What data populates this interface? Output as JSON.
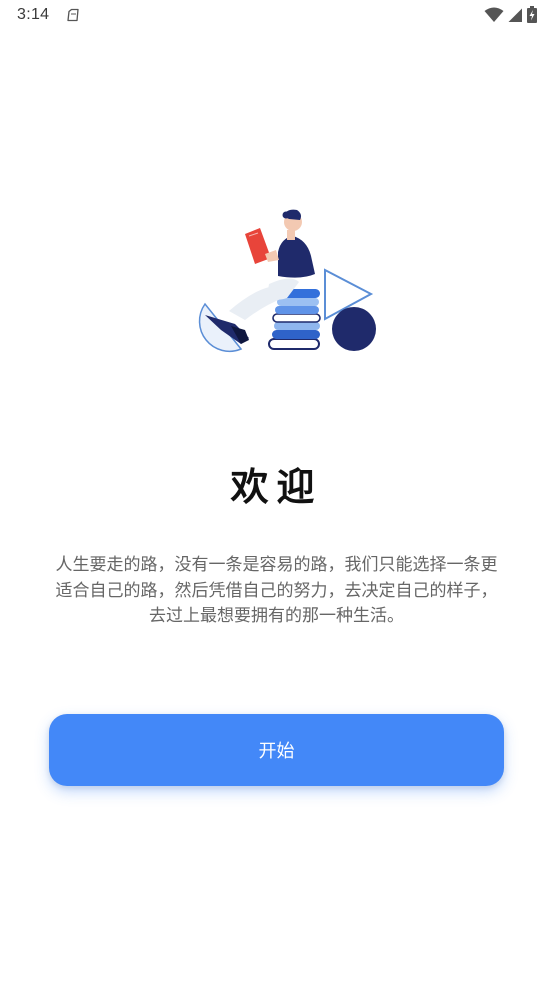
{
  "status_bar": {
    "time": "3:14",
    "icons": [
      "sim-card-icon",
      "wifi-icon",
      "signal-icon",
      "battery-charging-icon"
    ]
  },
  "welcome": {
    "title": "欢迎",
    "lines": [
      "人生要走的路，没有一条是容易的路，我们只能选择一条更",
      "适合自己的路，然后凭借自己的努力，去决定自己的样子，",
      "去过上最想要拥有的那一种生活。"
    ]
  },
  "start_button": {
    "label": "开始"
  },
  "colors": {
    "accent": "#4388f8",
    "navy": "#1f2a6b",
    "book_red": "#e8443a",
    "title": "#111111",
    "body_text": "#666666"
  }
}
